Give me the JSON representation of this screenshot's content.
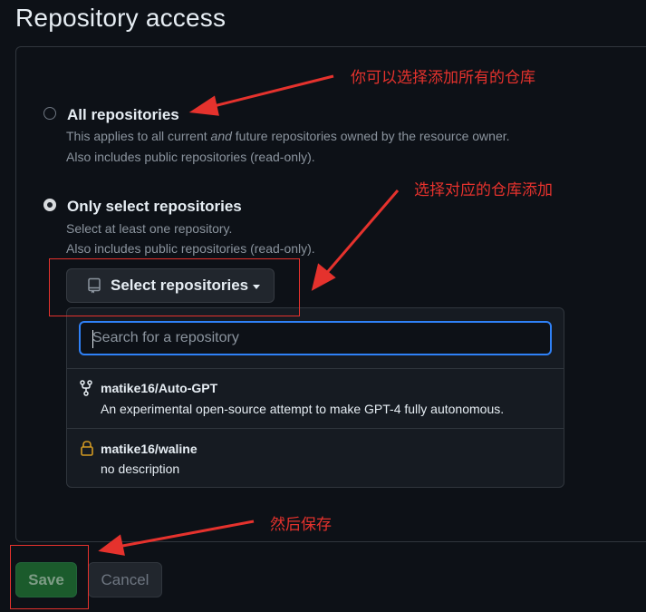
{
  "page": {
    "title": "Repository access"
  },
  "options": [
    {
      "label": "All repositories",
      "selected": false,
      "desc1_pre": "This applies to all current ",
      "desc1_em": "and",
      "desc1_post": " future repositories owned by the resource owner.",
      "desc2": "Also includes public repositories (read-only)."
    },
    {
      "label": "Only select repositories",
      "selected": true,
      "desc1": "Select at least one repository.",
      "desc2": "Also includes public repositories (read-only)."
    }
  ],
  "select_button": {
    "label": "Select repositories",
    "icon": "repo-icon"
  },
  "dropdown": {
    "search_placeholder": "Search for a repository",
    "repos": [
      {
        "name": "matike16/Auto-GPT",
        "desc": "An experimental open-source attempt to make GPT-4 fully autonomous.",
        "icon": "fork-icon"
      },
      {
        "name": "matike16/waline",
        "desc": "no description",
        "icon": "lock-icon"
      }
    ]
  },
  "actions": {
    "save": "Save",
    "cancel": "Cancel"
  },
  "annotations": {
    "note_all": "你可以选择添加所有的仓库",
    "note_select": "选择对应的仓库添加",
    "note_save": "然后保存"
  },
  "colors": {
    "annotation_red": "#e5322d",
    "focus_blue": "#2f81f7",
    "save_green": "#1b5b2c",
    "background": "#0d1117"
  }
}
